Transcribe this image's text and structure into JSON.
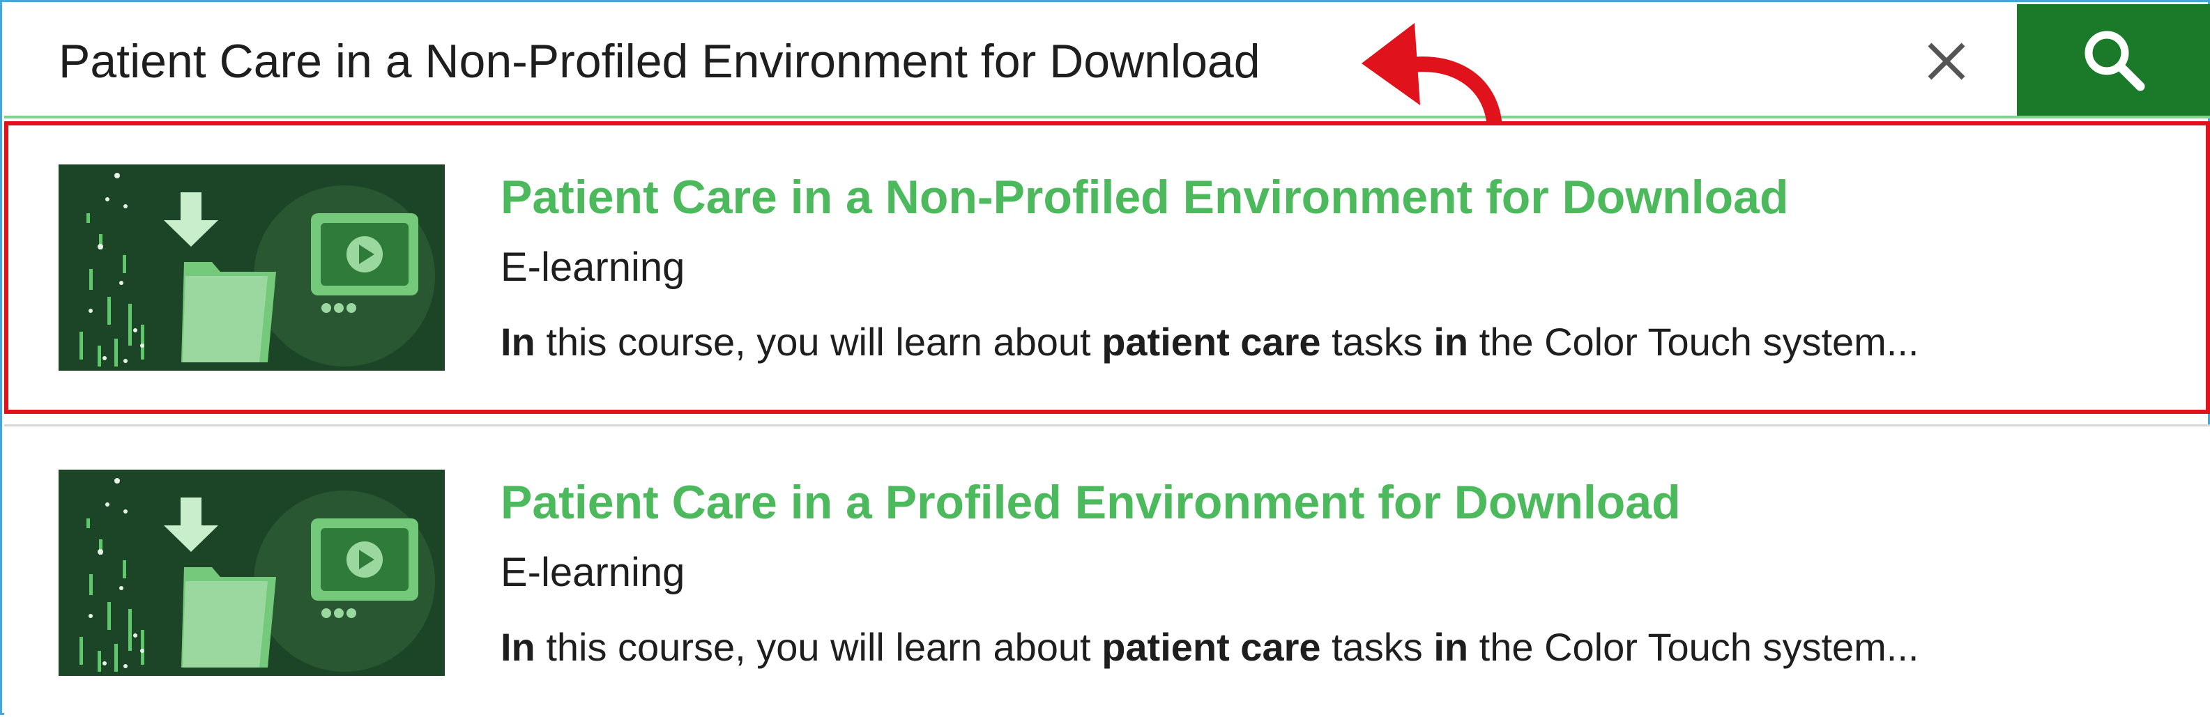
{
  "search": {
    "query": "Patient Care in a Non-Profiled Environment for Download",
    "clear_icon": "close-icon",
    "search_icon": "search-icon"
  },
  "results": [
    {
      "title": "Patient Care in a Non-Profiled Environment for Download",
      "type": "E-learning",
      "description_parts": [
        "In",
        " this course, you will learn about ",
        "patient care",
        " tasks ",
        "in",
        " the Color Touch system..."
      ],
      "thumbnail_icon": "download-folder-video-icon",
      "highlighted": true
    },
    {
      "title": "Patient Care in a Profiled Environment for Download",
      "type": "E-learning",
      "description_parts": [
        "In",
        " this course, you will learn about ",
        "patient care",
        " tasks ",
        "in",
        " the Color Touch system..."
      ],
      "thumbnail_icon": "download-folder-video-icon",
      "highlighted": false
    }
  ],
  "colors": {
    "title_green": "#4cba5c",
    "search_button": "#1a7a2a",
    "highlight_red": "#e0121b",
    "thumbnail_bg": "#1c4427"
  }
}
